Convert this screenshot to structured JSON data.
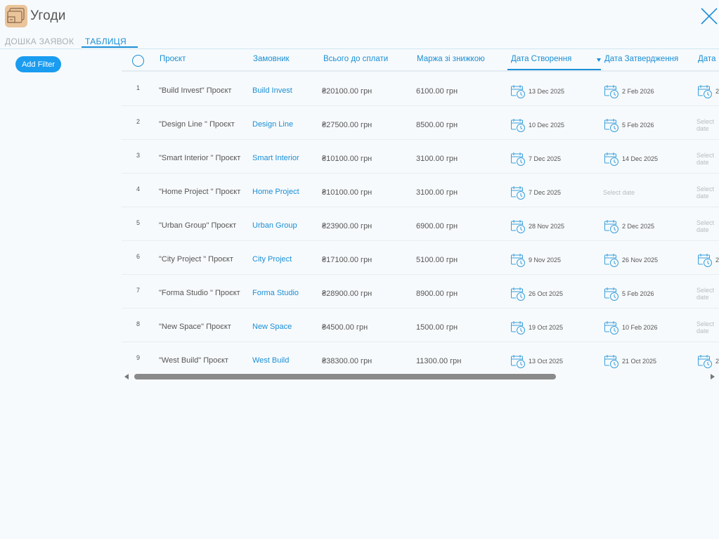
{
  "app": {
    "title": "Угоди",
    "icon": "briefcase-app-icon",
    "accent_color": "#1a8fd6",
    "button_color": "#1a9cf0"
  },
  "tabs": [
    {
      "label": "ДОШКА ЗАЯВОК",
      "active": false
    },
    {
      "label": "ТАБЛИЦЯ",
      "active": true
    }
  ],
  "filter": {
    "add_label": "Add Filter"
  },
  "table": {
    "columns": [
      "Проєкт",
      "Замовник",
      "Всього до сплати",
      "Маржа зі знижкою",
      "Дата Створення",
      "Дата Затвердження",
      "Дата"
    ],
    "sorted_column": "Дата Створення",
    "sort_direction": "descending",
    "date_placeholder": "Select date",
    "rows": [
      {
        "num": "1",
        "project": "\"Build Invest\" Проєкт",
        "client": "Build Invest",
        "total": "₴20100.00 грн",
        "margin": "6100.00 грн",
        "created": "13 Dec 2025",
        "approved": "2 Feb 2026",
        "third": "2"
      },
      {
        "num": "2",
        "project": "\"Design Line \" Проєкт",
        "client": "Design Line",
        "total": "₴27500.00 грн",
        "margin": "8500.00 грн",
        "created": "10 Dec 2025",
        "approved": "5 Feb 2026",
        "third": ""
      },
      {
        "num": "3",
        "project": "\"Smart Interior \" Проєкт",
        "client": "Smart Interior",
        "total": "₴10100.00 грн",
        "margin": "3100.00 грн",
        "created": "7 Dec 2025",
        "approved": "14 Dec 2025",
        "third": ""
      },
      {
        "num": "4",
        "project": "\"Home Project \" Проєкт",
        "client": "Home Project",
        "total": "₴10100.00 грн",
        "margin": "3100.00 грн",
        "created": "7 Dec 2025",
        "approved": "",
        "third": ""
      },
      {
        "num": "5",
        "project": "\"Urban Group\" Проєкт",
        "client": "Urban Group",
        "total": "₴23900.00 грн",
        "margin": "6900.00 грн",
        "created": "28 Nov 2025",
        "approved": "2 Dec 2025",
        "third": ""
      },
      {
        "num": "6",
        "project": "\"City Project \" Проєкт",
        "client": "City Project",
        "total": "₴17100.00 грн",
        "margin": "5100.00 грн",
        "created": "9 Nov 2025",
        "approved": "26 Nov 2025",
        "third": "2"
      },
      {
        "num": "7",
        "project": "\"Forma Studio \" Проєкт",
        "client": "Forma Studio",
        "total": "₴28900.00 грн",
        "margin": "8900.00 грн",
        "created": "26 Oct 2025",
        "approved": "5 Feb 2026",
        "third": ""
      },
      {
        "num": "8",
        "project": "\"New Space\" Проєкт",
        "client": "New Space",
        "total": "₴4500.00 грн",
        "margin": "1500.00 грн",
        "created": "19 Oct 2025",
        "approved": "10 Feb 2026",
        "third": ""
      },
      {
        "num": "9",
        "project": "\"West Build\" Проєкт",
        "client": "West Build",
        "total": "₴38300.00 грн",
        "margin": "11300.00 грн",
        "created": "13 Oct 2025",
        "approved": "21 Oct 2025",
        "third": "2"
      }
    ]
  }
}
